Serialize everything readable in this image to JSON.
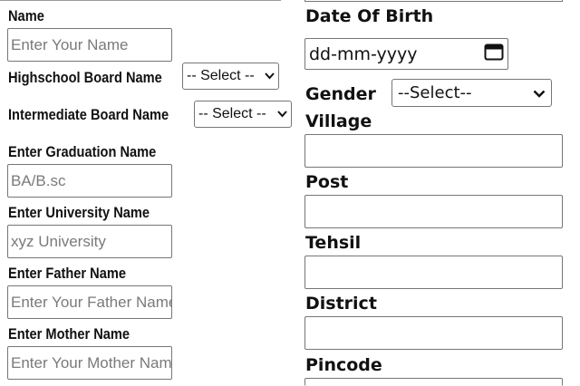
{
  "left": {
    "name": {
      "label": "Name",
      "placeholder": "Enter Your Name"
    },
    "highschool": {
      "label": "Highschool Board Name",
      "selected": "-- Select --"
    },
    "intermediate": {
      "label": "Intermediate Board Name",
      "selected": "-- Select --"
    },
    "graduation": {
      "label": "Enter Graduation Name",
      "placeholder": "BA/B.sc"
    },
    "university": {
      "label": "Enter University Name",
      "placeholder": "xyz University"
    },
    "father": {
      "label": "Enter Father Name",
      "placeholder": "Enter Your Father Name"
    },
    "mother": {
      "label": "Enter Mother Name",
      "placeholder": "Enter Your Mother Name"
    }
  },
  "right": {
    "dob": {
      "label": "Date Of Birth",
      "placeholder": "dd-mm-yyyy"
    },
    "gender": {
      "label": "Gender",
      "selected": "--Select--"
    },
    "village": {
      "label": "Village"
    },
    "post": {
      "label": "Post"
    },
    "tehsil": {
      "label": "Tehsil"
    },
    "district": {
      "label": "District"
    },
    "pincode": {
      "label": "Pincode"
    }
  },
  "icons": {
    "calendar": "calendar-icon",
    "chevron": "chevron-down-icon"
  }
}
